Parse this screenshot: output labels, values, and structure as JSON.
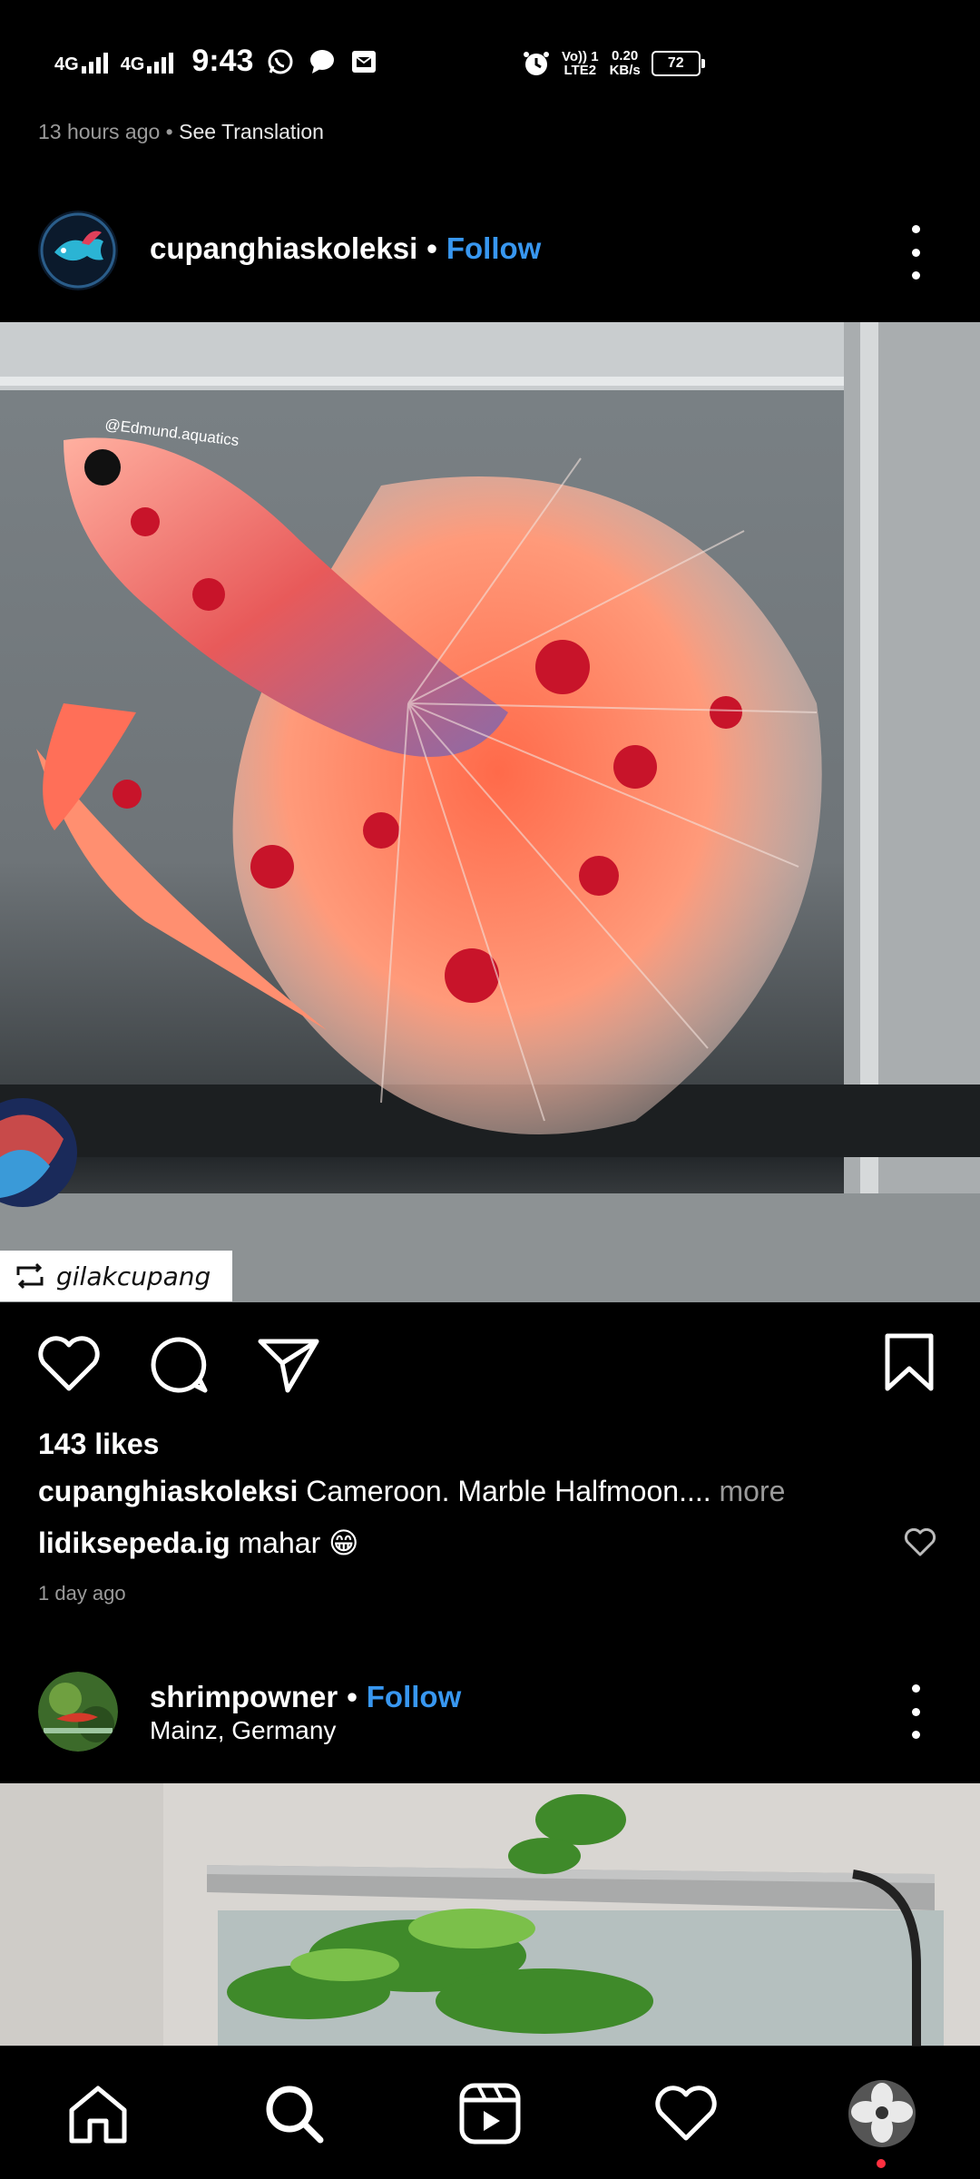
{
  "status_bar": {
    "network_1": "4G",
    "network_2": "4G",
    "time": "9:43",
    "volte_top": "Vo)) 1",
    "volte_bottom": "LTE2",
    "speed_value": "0.20",
    "speed_unit": "KB/s",
    "battery": "72"
  },
  "post_1": {
    "meta_time": "13 hours ago",
    "meta_separator": "•",
    "meta_translation": "See Translation",
    "username": "cupanghiaskoleksi",
    "separator": "•",
    "follow_label": "Follow",
    "image_watermark": "@Edmund.aquatics",
    "repost_user": "gilakcupang",
    "likes": "143 likes",
    "caption_user": "cupanghiaskoleksi",
    "caption_text": "Cameroon. Marble Halfmoon....",
    "caption_more": "more",
    "comment_user": "lidiksepeda.ig",
    "comment_text": "mahar 😁",
    "timestamp": "1 day ago"
  },
  "post_2": {
    "username": "shrimpowner",
    "separator": "•",
    "follow_label": "Follow",
    "location": "Mainz, Germany"
  },
  "colors": {
    "background": "#000000",
    "follow_blue": "#3897f0",
    "secondary_text": "#9a9a9a",
    "notification_dot": "#ff3040"
  },
  "icons": {
    "nav": [
      "home-icon",
      "search-icon",
      "reels-icon",
      "heart-icon",
      "profile-avatar"
    ],
    "post_actions": [
      "heart-icon",
      "comment-icon",
      "share-icon",
      "bookmark-icon"
    ]
  }
}
